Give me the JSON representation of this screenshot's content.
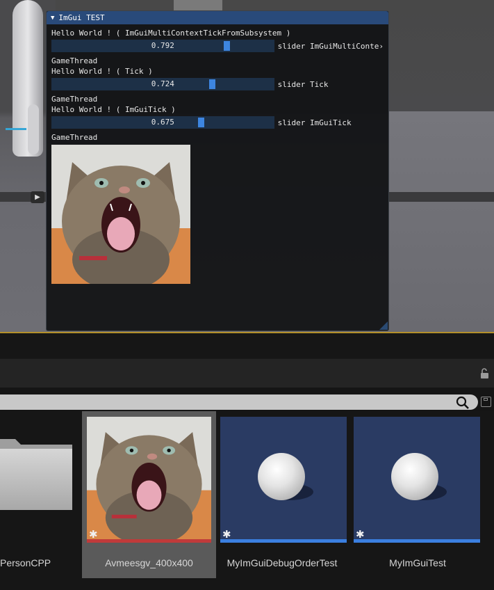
{
  "imgui": {
    "title": "ImGui TEST",
    "collapse_glyph": "▼",
    "sections": [
      {
        "hello": "Hello World ! ( ImGuiMultiContextTickFromSubsystem )",
        "slider_value": 0.792,
        "slider_text": "0.792",
        "slider_label": "slider ImGuiMultiConte›",
        "thread": "GameThread"
      },
      {
        "hello": "Hello World ! ( Tick )",
        "slider_value": 0.724,
        "slider_text": "0.724",
        "slider_label": "slider Tick",
        "thread": "GameThread"
      },
      {
        "hello": "Hello World ! ( ImGuiTick )",
        "slider_value": 0.675,
        "slider_text": "0.675",
        "slider_label": "slider ImGuiTick",
        "thread": "GameThread"
      }
    ],
    "image_icon": "screaming-cat-image"
  },
  "viewport": {
    "play_glyph": "▶"
  },
  "toolbar": {
    "lock_glyph": "🔓",
    "lock_icon": "padlock-unlocked-icon"
  },
  "search": {
    "placeholder": "",
    "icon": "search-icon",
    "save_icon": "save-icon"
  },
  "assets": [
    {
      "label": "PersonCPP",
      "kind": "folder"
    },
    {
      "label": "Avmeesgv_400x400",
      "kind": "texture",
      "selected": true,
      "bar_color": "#c03a3a"
    },
    {
      "label": "MyImGuiDebugOrderTest",
      "kind": "blueprint",
      "bar_color": "#3b7fe0"
    },
    {
      "label": "MyImGuiTest",
      "kind": "blueprint",
      "bar_color": "#3b7fe0"
    }
  ],
  "asset_star_glyph": "✱",
  "colors": {
    "imgui_title": "#294a7a",
    "slider_grab": "#3d85e0",
    "accent_gold": "#b38f2a",
    "thumb_bg": "#2a3b63"
  }
}
